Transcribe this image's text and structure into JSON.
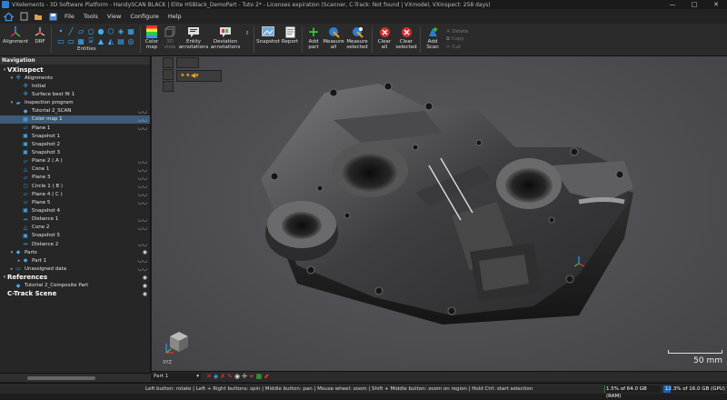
{
  "window": {
    "title": "VXelements - 3D Software Platform - HandySCAN BLACK | Elite HSBlack_DemoPart - Tuto 2* - Licenses expiration (Scanner, C-Track: Not found | VXmodel, VXinspect: 258 days)",
    "minimize": "—",
    "maximize": "□",
    "close": "✕"
  },
  "menu": [
    "File",
    "Tools",
    "View",
    "Configure",
    "Help"
  ],
  "ribbon": {
    "alignment": "Alignment",
    "drf": "DRF",
    "entities": "Entities",
    "color_map": "Color map",
    "view_3d": "3D view",
    "entity_annotations": "Entity annotations",
    "deviation_annotations": "Deviation annotations",
    "snapshot": "Snapshot",
    "report": "Report",
    "add_part": "Add part",
    "measure_all": "Measure all",
    "measure_selected": "Measure selected",
    "clear_all": "Clear all",
    "clear_selected": "Clear selected",
    "add_scan": "Add Scan",
    "delete": "Delete",
    "copy": "Copy",
    "cut": "Cut"
  },
  "navigation": {
    "header": "Navigation",
    "tree": [
      {
        "label": "VXinspect",
        "level": 0,
        "bold": true,
        "toggle": "▾",
        "icon": ""
      },
      {
        "label": "Alignments",
        "level": 1,
        "toggle": "▾",
        "icon": "✣"
      },
      {
        "label": "Initial",
        "level": 2,
        "toggle": "",
        "icon": "✣"
      },
      {
        "label": "Surface best fit 1",
        "level": 2,
        "toggle": "",
        "icon": "✣"
      },
      {
        "label": "Inspection program",
        "level": 1,
        "toggle": "▾",
        "icon": "▰"
      },
      {
        "label": "Tutorial 2_SCAN",
        "level": 2,
        "toggle": "",
        "icon": "◆",
        "eye": "◡◡"
      },
      {
        "label": "Color map 1",
        "level": 2,
        "toggle": "",
        "icon": "▦",
        "selected": true,
        "eye": "◡◡"
      },
      {
        "label": "Plane 1",
        "level": 2,
        "toggle": "",
        "icon": "▱",
        "eye": "◡◡"
      },
      {
        "label": "Snapshot 1",
        "level": 2,
        "toggle": "",
        "icon": "▣"
      },
      {
        "label": "Snapshot 2",
        "level": 2,
        "toggle": "",
        "icon": "▣"
      },
      {
        "label": "Snapshot 3",
        "level": 2,
        "toggle": "",
        "icon": "▣"
      },
      {
        "label": "Plane 2 ( A )",
        "level": 2,
        "toggle": "",
        "icon": "▱",
        "eye": "◡◡"
      },
      {
        "label": "Cone 1",
        "level": 2,
        "toggle": "",
        "icon": "△",
        "eye": "◡◡"
      },
      {
        "label": "Plane 3",
        "level": 2,
        "toggle": "",
        "icon": "▱",
        "eye": "◡◡"
      },
      {
        "label": "Circle 1 ( B )",
        "level": 2,
        "toggle": "",
        "icon": "○",
        "eye": "◡◡"
      },
      {
        "label": "Plane 4 ( C )",
        "level": 2,
        "toggle": "",
        "icon": "▱",
        "eye": "◡◡"
      },
      {
        "label": "Plane 5",
        "level": 2,
        "toggle": "",
        "icon": "▱",
        "eye": "◡◡"
      },
      {
        "label": "Snapshot 4",
        "level": 2,
        "toggle": "",
        "icon": "▣"
      },
      {
        "label": "Distance 1",
        "level": 2,
        "toggle": "",
        "icon": "↔",
        "eye": "◡◡"
      },
      {
        "label": "Cone 2",
        "level": 2,
        "toggle": "",
        "icon": "△",
        "eye": "◡◡"
      },
      {
        "label": "Snapshot 5",
        "level": 2,
        "toggle": "",
        "icon": "▣"
      },
      {
        "label": "Distance 2",
        "level": 2,
        "toggle": "",
        "icon": "↔",
        "eye": "◡◡"
      },
      {
        "label": "Parts",
        "level": 1,
        "toggle": "▾",
        "icon": "◆",
        "eye": "◉"
      },
      {
        "label": "Part 1",
        "level": 2,
        "toggle": "▸",
        "icon": "◆",
        "eye": "◡◡"
      },
      {
        "label": "Unassigned data",
        "level": 1,
        "toggle": "▸",
        "icon": "▭",
        "eye": "◡◡"
      },
      {
        "label": "References",
        "level": 0,
        "bold": true,
        "toggle": "▾",
        "icon": "",
        "eye": "◉"
      },
      {
        "label": "Tutorial 2_Composite Part",
        "level": 1,
        "toggle": "",
        "icon": "◆",
        "eye": "◉"
      },
      {
        "label": "C-Track Scene",
        "level": 0,
        "bold": true,
        "toggle": "",
        "icon": "",
        "eye": "◉"
      }
    ]
  },
  "viewport": {
    "scale_label": "50 mm",
    "axis_label": "XYZ"
  },
  "bottombar": {
    "part_select": "Part 1",
    "part_chevron": "▾"
  },
  "status": {
    "hint": "Left button: rotate | Left + Right buttons: spin | Middle button: pan | Mouse wheel: zoom | Shift + Middle button: zoom on region | Hold Ctrl: start selection",
    "ram_text": "1.5% of 64.0 GB (RAM)",
    "ram_pct": 1.5,
    "gpu_text": "12.3% of 16.0 GB (GPU)",
    "gpu_pct": 12.3
  },
  "colors": {
    "accent_blue": "#2a7fd4",
    "selection": "#3d5a78",
    "ram_bar": "#2e7d32",
    "gpu_bar": "#1565c0"
  }
}
